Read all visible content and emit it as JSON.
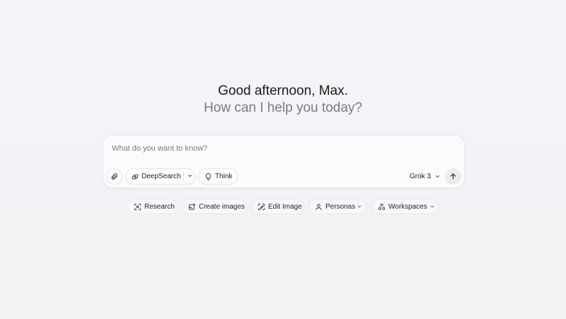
{
  "greeting": {
    "line1": "Good afternoon, Max.",
    "line2": "How can I help you today?"
  },
  "composer": {
    "placeholder": "What do you want to know?",
    "deepsearch_label": "DeepSearch",
    "think_label": "Think",
    "model_label": "Grok 3"
  },
  "actions": [
    {
      "label": "Research",
      "icon": "research-icon"
    },
    {
      "label": "Create images",
      "icon": "create-image-icon"
    },
    {
      "label": "Edit Image",
      "icon": "edit-image-icon"
    },
    {
      "label": "Personas",
      "icon": "person-icon"
    },
    {
      "label": "Workspaces",
      "icon": "workspaces-icon"
    }
  ],
  "colors": {
    "background": "#f5f4f8",
    "composer_bg": "#fbfafc",
    "send_bg": "#ececef",
    "muted_text": "#7a7a80"
  }
}
